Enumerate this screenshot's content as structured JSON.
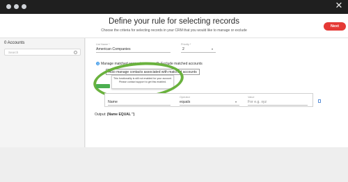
{
  "window": {
    "close_glyph": "✕"
  },
  "header": {
    "title": "Define your rule for selecting records",
    "subtitle": "Choose the criteria for selecting records in your CRM that you would like to manage or exclude",
    "next_label": "Next",
    "next_color": "#e53935"
  },
  "sidebar": {
    "title": "0 Accounts",
    "search_placeholder": "Search",
    "search_icon": "search-icon"
  },
  "rule": {
    "list_name_label": "List Name *",
    "list_name_value": "American Companies",
    "priority_label": "Priority *",
    "priority_value": "2",
    "radio_manage": "Manage matched accounts",
    "radio_exclude": "Exclude matched accounts",
    "assoc_text": "Also manage contacts associated with matched accounts",
    "tooltip": "This functionality is still not enabled for your account. Please contact support to get this enabled."
  },
  "condition": {
    "field_value": "Name",
    "operator_label": "Operator",
    "operator_value": "equals",
    "value_label": "Value",
    "value_placeholder": "For e.g. xyz"
  },
  "output": {
    "prefix": "Output:",
    "expression": "(Name EQUAL '')"
  },
  "colors": {
    "highlight_ring": "#6ab23e",
    "accent_blue": "#1e88e5"
  }
}
